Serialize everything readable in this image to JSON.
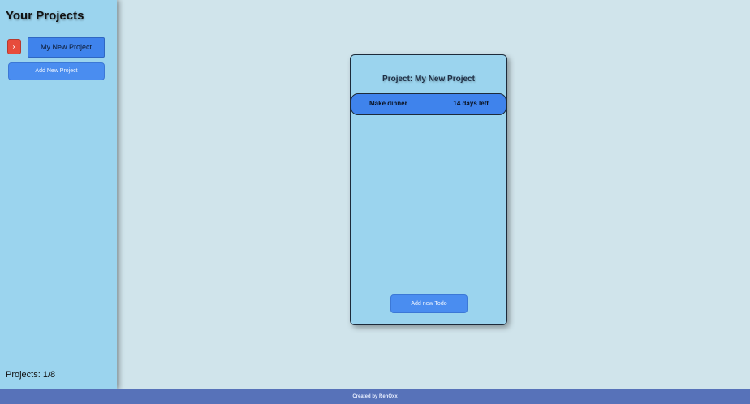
{
  "sidebar": {
    "title": "Your Projects",
    "projects": [
      {
        "delete_label": "x",
        "name": "My New Project"
      }
    ],
    "add_project_label": "Add New Project",
    "projects_count": "Projects: 1/8"
  },
  "project_panel": {
    "title": "Project: My New Project",
    "todos": [
      {
        "name": "Make dinner",
        "due": "14 days left"
      }
    ],
    "add_todo_label": "Add new Todo"
  },
  "footer": {
    "text": "Created by RenOxx"
  },
  "colors": {
    "background": "#d0e4eb",
    "sidebar": "#9bd4ee",
    "accent": "#3f83ec",
    "danger": "#e74c3c",
    "footer": "#5772b9"
  }
}
